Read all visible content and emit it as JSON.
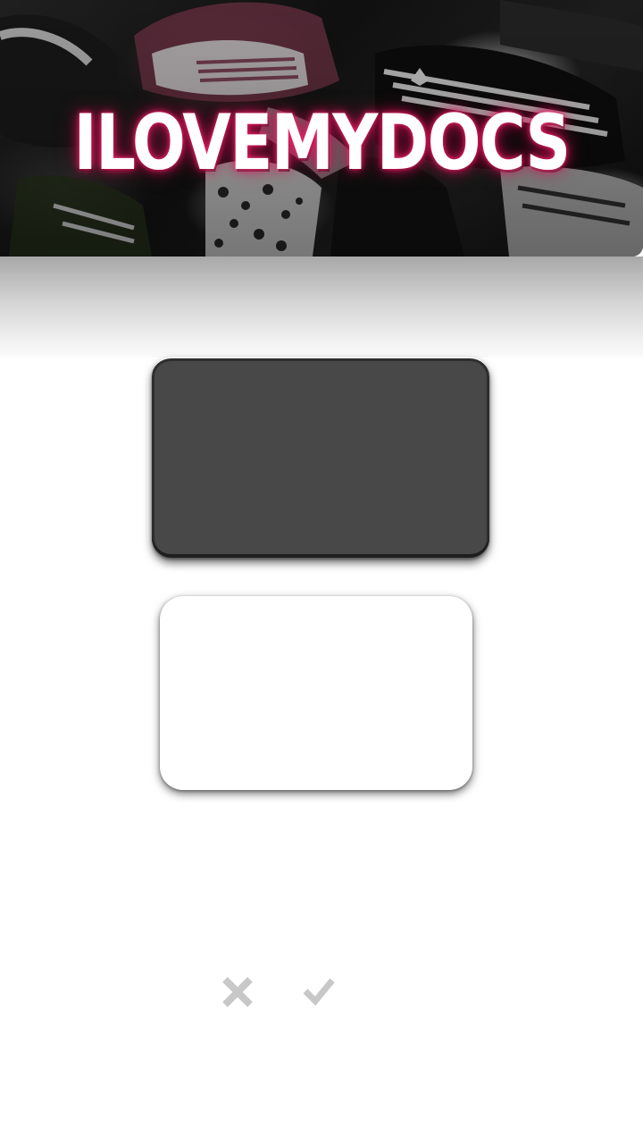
{
  "banner": {
    "title": "ILOVEMYDOCS",
    "glow_color": "#e8185f"
  },
  "cards": {
    "dark_card_color": "#484848",
    "light_card_color": "#ffffff"
  },
  "actions": {
    "cancel_icon": "close-icon",
    "confirm_icon": "check-icon",
    "icon_color": "#c8c8c8"
  }
}
